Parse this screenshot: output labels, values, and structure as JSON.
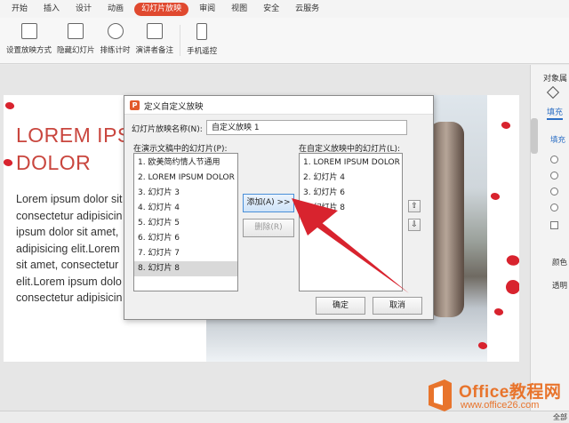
{
  "ribbon": {
    "tabs": [
      "开始",
      "插入",
      "设计",
      "动画",
      "幻灯片放映",
      "审阅",
      "视图",
      "安全",
      "云服务"
    ],
    "active_tab_index": 4,
    "tools": [
      "设置放映方式",
      "隐藏幻灯片",
      "排练计时",
      "演讲者备注",
      "手机遥控"
    ]
  },
  "slide": {
    "title_line1": "LOREM IPS",
    "title_line2": "DOLOR",
    "body_lines": [
      "Lorem ipsum dolor sit",
      "consectetur adipisicin",
      "ipsum dolor sit amet,",
      "adipisicing elit.Lorem",
      "sit amet, consectetur",
      "elit.Lorem ipsum dolo",
      "consectetur adipisicin"
    ]
  },
  "side_panel": {
    "title": "对象属",
    "tab_fill": "填充",
    "section_fill": "填充",
    "label_color": "颜色",
    "label_transparency": "透明"
  },
  "status_bar": {
    "right_text": "全部"
  },
  "dialog": {
    "title": "定义自定义放映",
    "name_label": "幻灯片放映名称(N):",
    "name_value": "自定义放映 1",
    "left_list_label": "在演示文稿中的幻灯片(P):",
    "right_list_label": "在自定义放映中的幻灯片(L):",
    "left_items": [
      "1. 欧美简约情人节通用",
      "2. LOREM IPSUM DOLOR",
      "3. 幻灯片 3",
      "4. 幻灯片 4",
      "5. 幻灯片 5",
      "6. 幻灯片 6",
      "7. 幻灯片 7",
      "8. 幻灯片 8"
    ],
    "left_selected_index": 7,
    "right_items": [
      "1. LOREM IPSUM DOLOR",
      "2. 幻灯片 4",
      "3. 幻灯片 6",
      "4. 幻灯片 8"
    ],
    "add_button": "添加(A) >>",
    "delete_button": "删除(R)",
    "ok_button": "确定",
    "cancel_button": "取消",
    "up_icon": "⇧",
    "down_icon": "⇩"
  },
  "watermark": {
    "title": "Office教程网",
    "url": "www.office26.com"
  },
  "colors": {
    "active_tab": "#e0492f",
    "accent_red": "#d8232e",
    "watermark_orange": "#e8742c",
    "link_blue": "#2d6fc4"
  }
}
